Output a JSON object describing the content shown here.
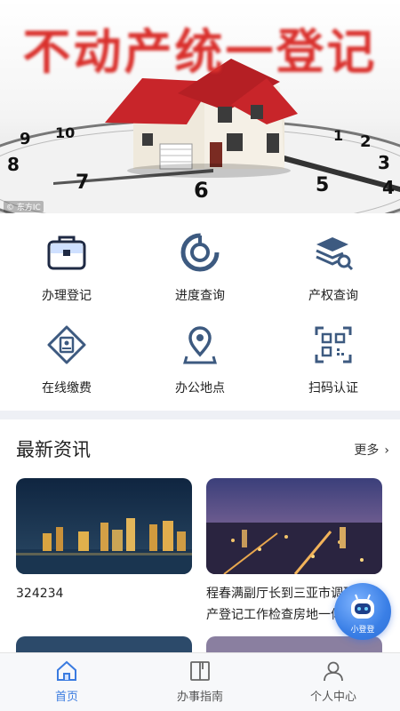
{
  "banner": {
    "title": "不动产统一登记",
    "watermark": "© 东方IC",
    "clock_numerals": [
      "8",
      "9",
      "10",
      "1",
      "2",
      "3",
      "4",
      "5",
      "6",
      "7"
    ]
  },
  "grid": [
    {
      "label": "办理登记",
      "icon": "briefcase-icon"
    },
    {
      "label": "进度查询",
      "icon": "progress-icon"
    },
    {
      "label": "产权查询",
      "icon": "stack-search-icon"
    },
    {
      "label": "在线缴费",
      "icon": "payment-icon"
    },
    {
      "label": "办公地点",
      "icon": "location-icon"
    },
    {
      "label": "扫码认证",
      "icon": "qr-scan-icon"
    }
  ],
  "news": {
    "section_title": "最新资讯",
    "more_label": "更多",
    "items": [
      {
        "caption": "324234",
        "image": "city-skyline-night"
      },
      {
        "caption": "程春满副厅长到三亚市调研不动产登记工作检查房地一体及集体建设",
        "image": "city-aerial-night"
      }
    ]
  },
  "assistant": {
    "label": "小登登"
  },
  "tabbar": {
    "items": [
      {
        "label": "首页",
        "icon": "home-icon",
        "active": true
      },
      {
        "label": "办事指南",
        "icon": "book-icon",
        "active": false
      },
      {
        "label": "个人中心",
        "icon": "user-icon",
        "active": false
      }
    ]
  },
  "colors": {
    "accent": "#3a7be0",
    "icon_stroke": "#3d5a80",
    "banner_red": "#d9302c",
    "section_bg": "#eef0f5"
  }
}
